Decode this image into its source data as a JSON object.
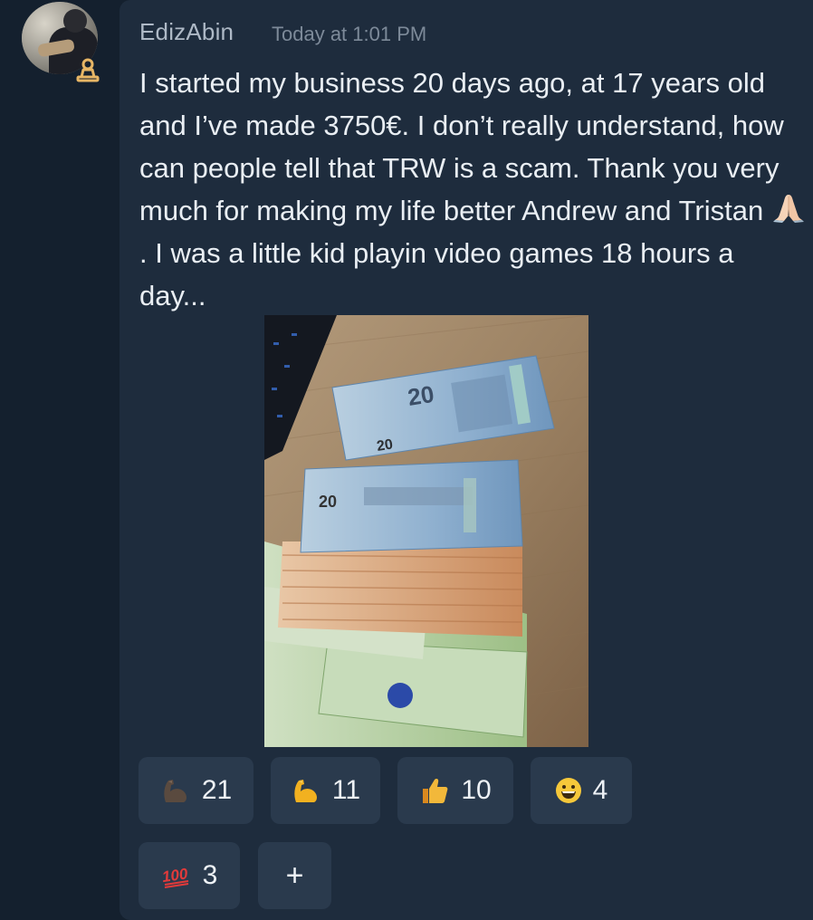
{
  "message": {
    "author": "EdizAbin",
    "timestamp": "Today at 1:01 PM",
    "text_before_emoji": "I started my business 20 days ago, at 17 years old and I’ve made 3750€. I don’t really understand, how can people tell that TRW is a scam. Thank you very much for making my life better Andrew and Tristan ",
    "text_after_emoji": ". I was a little kid playin video games 18 hours a day...",
    "inline_emoji": "folded-hands"
  },
  "attachment": {
    "type": "photo",
    "subject": "euro-banknotes",
    "note_denomination_label": "20"
  },
  "reactions": [
    {
      "icon": "dark-flexed-biceps",
      "count": "21"
    },
    {
      "icon": "flexed-biceps",
      "count": "11"
    },
    {
      "icon": "thumbs-up",
      "count": "10"
    },
    {
      "icon": "grinning-face",
      "count": "4"
    },
    {
      "icon": "hundred-points",
      "count": "3"
    }
  ],
  "add_reaction_label": "+",
  "colors": {
    "background": "#14202e",
    "card": "#1e2c3d",
    "reaction_bg": "#2a3a4d",
    "text": "#e9eef3",
    "muted": "#7d8a99",
    "badge": "#e7b665"
  }
}
